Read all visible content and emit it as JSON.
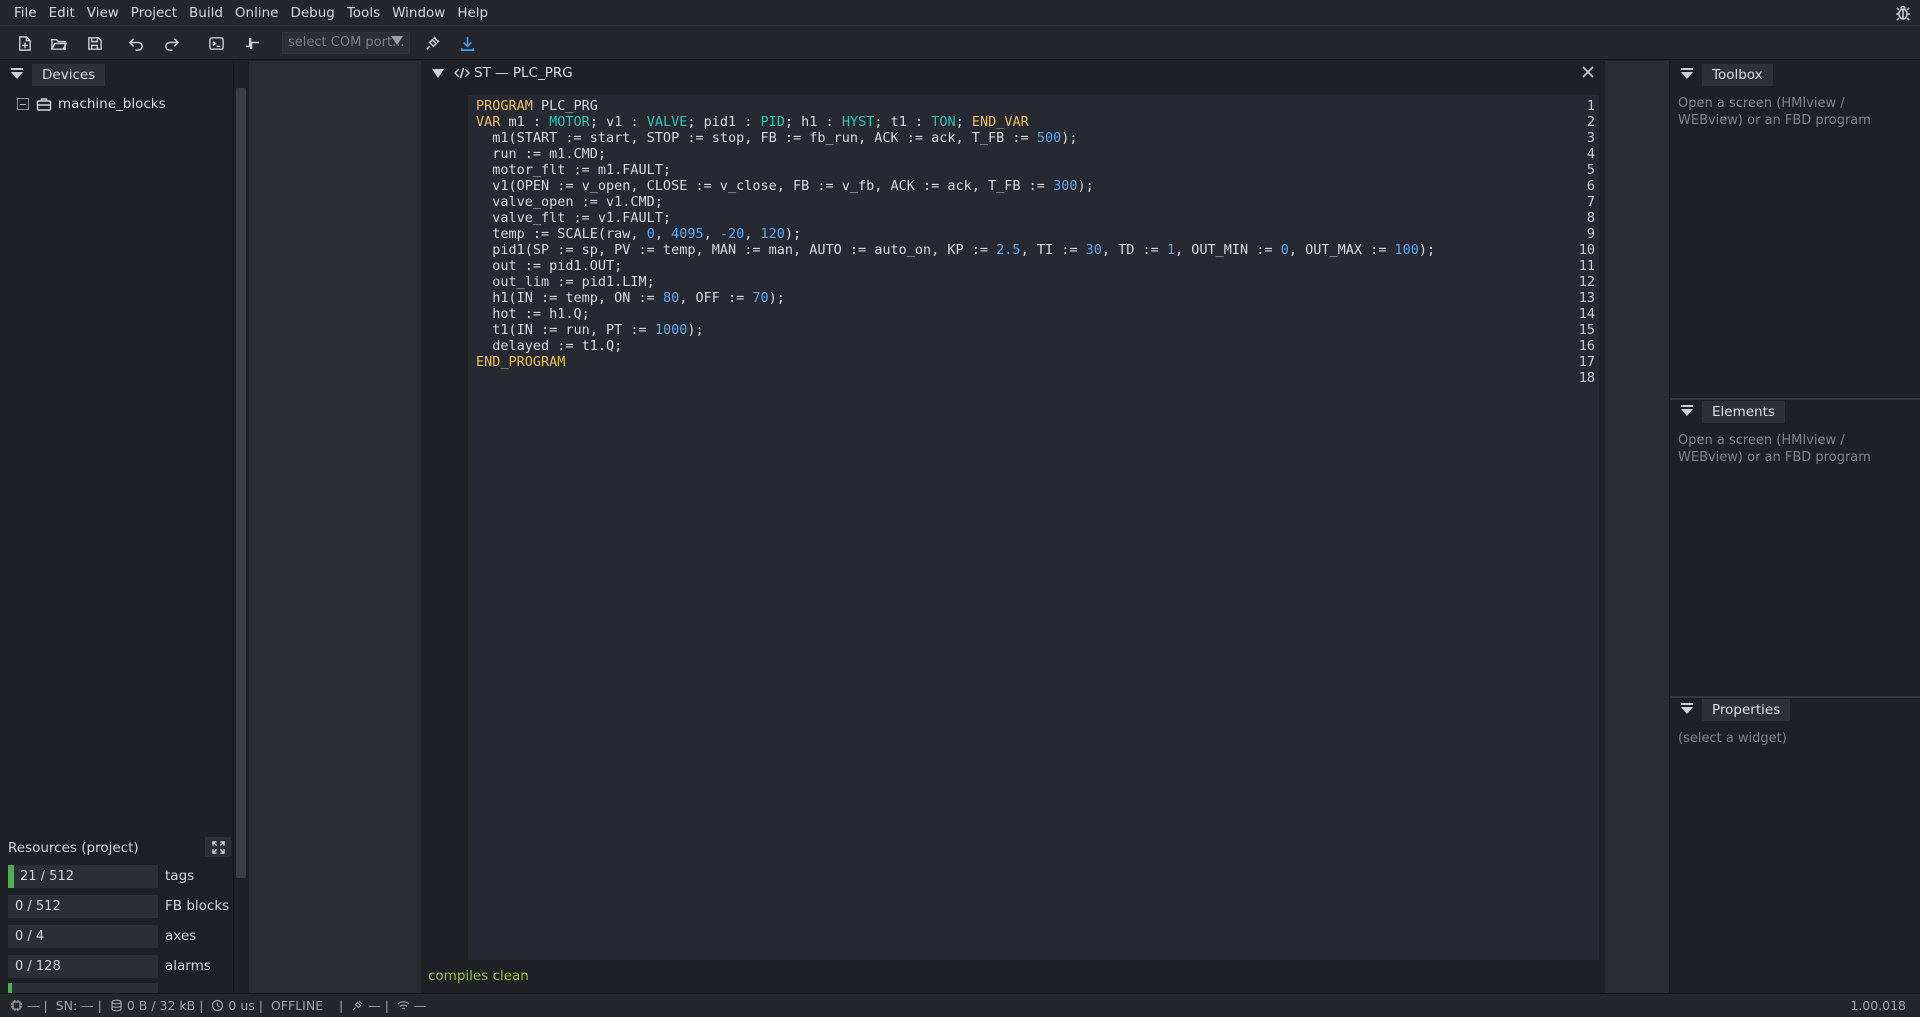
{
  "menu": [
    "File",
    "Edit",
    "View",
    "Project",
    "Build",
    "Online",
    "Debug",
    "Tools",
    "Window",
    "Help"
  ],
  "toolbar": {
    "com_port_placeholder": "select COM port..."
  },
  "devices": {
    "tab_label": "Devices",
    "tree_root": "machine_blocks"
  },
  "resources": {
    "title": "Resources (project)",
    "rows": [
      {
        "value": "21 / 512",
        "label": "tags",
        "fill": 0.041
      },
      {
        "value": "0 / 512",
        "label": "FB blocks (fl",
        "fill": 0
      },
      {
        "value": "0 / 4",
        "label": "axes",
        "fill": 0
      },
      {
        "value": "0 / 128",
        "label": "alarms",
        "fill": 0
      }
    ]
  },
  "editor": {
    "title": "ST — PLC_PRG",
    "line_numbers": [
      "1",
      "2",
      "3",
      "4",
      "5",
      "6",
      "7",
      "8",
      "9",
      "10",
      "11",
      "12",
      "13",
      "14",
      "15",
      "16",
      "17",
      "18"
    ],
    "lines": [
      [
        [
          "kw",
          "PROGRAM"
        ],
        [
          "t",
          " PLC_PRG"
        ]
      ],
      [
        [
          "kw",
          "VAR"
        ],
        [
          "t",
          " m1 : "
        ],
        [
          "ty",
          "MOTOR"
        ],
        [
          "t",
          "; v1 : "
        ],
        [
          "ty",
          "VALVE"
        ],
        [
          "t",
          "; pid1 : "
        ],
        [
          "ty",
          "PID"
        ],
        [
          "t",
          "; h1 : "
        ],
        [
          "ty",
          "HYST"
        ],
        [
          "t",
          "; t1 : "
        ],
        [
          "ty",
          "TON"
        ],
        [
          "t",
          "; "
        ],
        [
          "kw",
          "END_VAR"
        ]
      ],
      [
        [
          "t",
          "  m1(START := start, STOP := stop, FB := fb_run, ACK := ack, T_FB := "
        ],
        [
          "num",
          "500"
        ],
        [
          "t",
          ");"
        ]
      ],
      [
        [
          "t",
          "  run := m1.CMD;"
        ]
      ],
      [
        [
          "t",
          "  motor_flt := m1.FAULT;"
        ]
      ],
      [
        [
          "t",
          "  v1(OPEN := v_open, CLOSE := v_close, FB := v_fb, ACK := ack, T_FB := "
        ],
        [
          "num",
          "300"
        ],
        [
          "t",
          ");"
        ]
      ],
      [
        [
          "t",
          "  valve_open := v1.CMD;"
        ]
      ],
      [
        [
          "t",
          "  valve_flt := v1.FAULT;"
        ]
      ],
      [
        [
          "t",
          "  temp := SCALE(raw, "
        ],
        [
          "num",
          "0"
        ],
        [
          "t",
          ", "
        ],
        [
          "num",
          "4095"
        ],
        [
          "t",
          ", "
        ],
        [
          "num",
          "-20"
        ],
        [
          "t",
          ", "
        ],
        [
          "num",
          "120"
        ],
        [
          "t",
          ");"
        ]
      ],
      [
        [
          "t",
          "  pid1(SP := sp, PV := temp, MAN := man, AUTO := auto_on, KP := "
        ],
        [
          "num",
          "2.5"
        ],
        [
          "t",
          ", TI := "
        ],
        [
          "num",
          "30"
        ],
        [
          "t",
          ", TD := "
        ],
        [
          "num",
          "1"
        ],
        [
          "t",
          ", OUT_MIN := "
        ],
        [
          "num",
          "0"
        ],
        [
          "t",
          ", OUT_MAX := "
        ],
        [
          "num",
          "100"
        ],
        [
          "t",
          ");"
        ]
      ],
      [
        [
          "t",
          "  out := pid1.OUT;"
        ]
      ],
      [
        [
          "t",
          "  out_lim := pid1.LIM;"
        ]
      ],
      [
        [
          "t",
          "  h1(IN := temp, ON := "
        ],
        [
          "num",
          "80"
        ],
        [
          "t",
          ", OFF := "
        ],
        [
          "num",
          "70"
        ],
        [
          "t",
          ");"
        ]
      ],
      [
        [
          "t",
          "  hot := h1.Q;"
        ]
      ],
      [
        [
          "t",
          "  t1(IN := run, PT := "
        ],
        [
          "num",
          "1000"
        ],
        [
          "t",
          ");"
        ]
      ],
      [
        [
          "t",
          "  delayed := t1.Q;"
        ]
      ],
      [
        [
          "kw",
          "END_PROGRAM"
        ]
      ],
      [
        [
          "t",
          ""
        ]
      ]
    ],
    "status": "compiles clean"
  },
  "toolbox": {
    "title": "Toolbox",
    "message": "Open a screen (HMIview / WEBview) or an FBD program"
  },
  "elements": {
    "title": "Elements",
    "message": "Open a screen (HMIview / WEBview) or an FBD program"
  },
  "properties": {
    "title": "Properties",
    "message": "(select a widget)"
  },
  "statusbar": {
    "device": "—",
    "sn": "SN: —",
    "memory": "0 B / 32 kB",
    "cycle": "0 us",
    "mode": "OFFLINE",
    "link": "—",
    "signal": "—",
    "version": "1.00.018"
  },
  "colors": {
    "keyword": "#e8c060",
    "type": "#2ec4b6",
    "number": "#5aa8f0",
    "success": "#8bc34a",
    "accent": "#4caf50"
  }
}
